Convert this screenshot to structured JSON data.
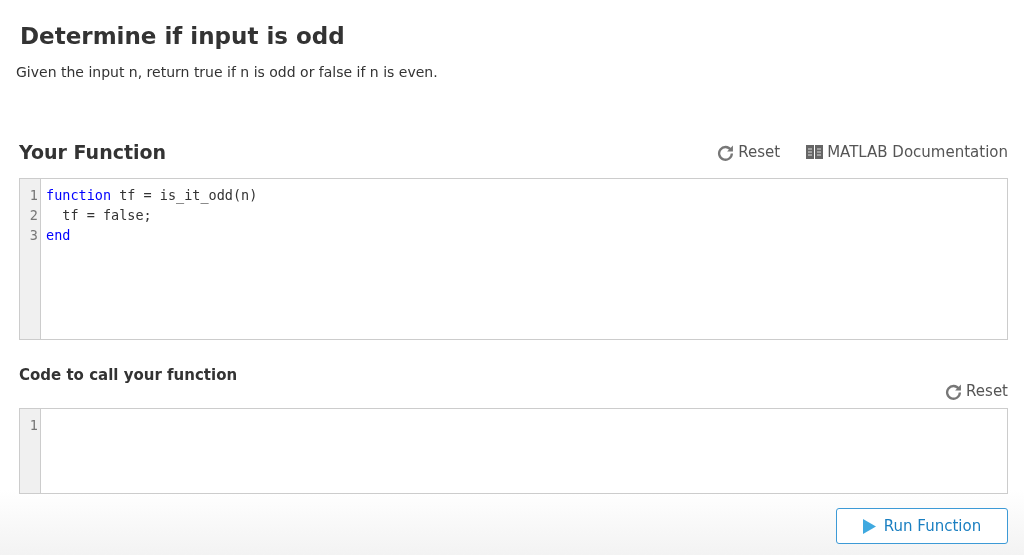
{
  "title": "Determine if input is odd",
  "description": "Given the input n, return true if n is odd or false if n is even.",
  "sections": [
    {
      "heading": "Your Function",
      "kind": "main",
      "actions": [
        {
          "kind": "reset",
          "label": "Reset"
        },
        {
          "kind": "docs",
          "label": "MATLAB Documentation"
        }
      ],
      "editor": {
        "lines": [
          {
            "number": "1",
            "tokens": [
              {
                "text": "function",
                "kind": "keyword"
              },
              {
                "text": " tf = is_it_odd(n)",
                "kind": "plain"
              }
            ]
          },
          {
            "number": "2",
            "tokens": [
              {
                "text": "  tf = false;",
                "kind": "plain"
              }
            ]
          },
          {
            "number": "3",
            "tokens": [
              {
                "text": "end",
                "kind": "keyword"
              }
            ]
          }
        ]
      }
    },
    {
      "heading": "Code to call your function",
      "kind": "sub",
      "actions": [
        {
          "kind": "reset",
          "label": "Reset"
        }
      ],
      "editor": {
        "lines": [
          {
            "number": "1"
          }
        ]
      }
    }
  ],
  "run_button": {
    "label": "Run Function"
  }
}
